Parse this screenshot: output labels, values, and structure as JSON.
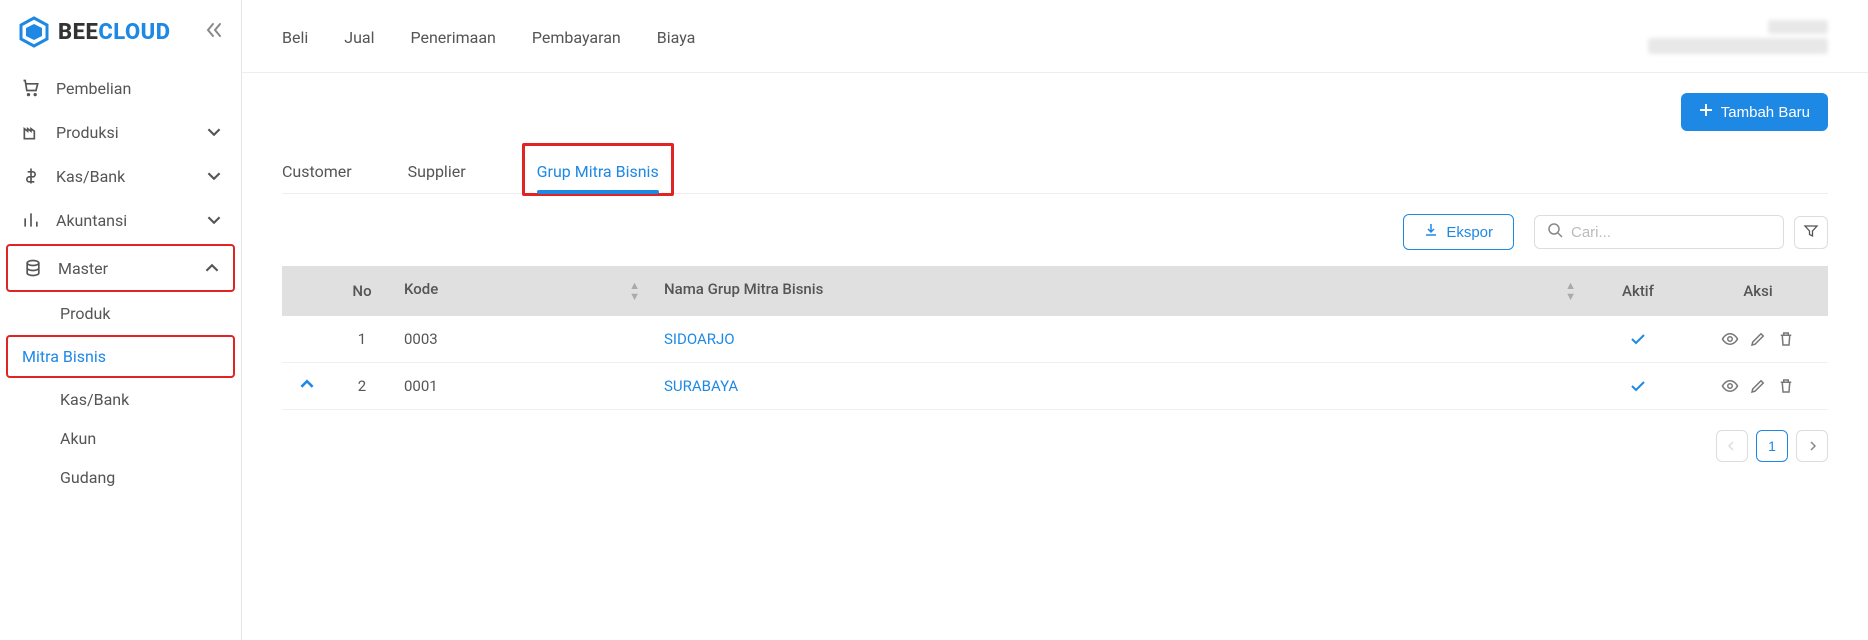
{
  "brand": {
    "bee": "BEE",
    "cloud": "CLOUD"
  },
  "sidebar": {
    "items": [
      {
        "label": "Pembelian",
        "icon": "cart",
        "expandable": false
      },
      {
        "label": "Produksi",
        "icon": "factory",
        "expandable": true
      },
      {
        "label": "Kas/Bank",
        "icon": "dollar",
        "expandable": true
      },
      {
        "label": "Akuntansi",
        "icon": "bars",
        "expandable": true
      },
      {
        "label": "Master",
        "icon": "db",
        "expandable": true,
        "open": true
      }
    ],
    "master_children": [
      {
        "label": "Produk"
      },
      {
        "label": "Mitra Bisnis",
        "active": true
      },
      {
        "label": "Kas/Bank"
      },
      {
        "label": "Akun"
      },
      {
        "label": "Gudang"
      }
    ]
  },
  "topnav": [
    "Beli",
    "Jual",
    "Penerimaan",
    "Pembayaran",
    "Biaya"
  ],
  "buttons": {
    "add": "Tambah Baru",
    "export": "Ekspor"
  },
  "search": {
    "placeholder": "Cari..."
  },
  "tabs": [
    "Customer",
    "Supplier",
    "Grup Mitra Bisnis"
  ],
  "table": {
    "headers": {
      "no": "No",
      "kode": "Kode",
      "nama": "Nama Grup Mitra Bisnis",
      "aktif": "Aktif",
      "aksi": "Aksi"
    },
    "rows": [
      {
        "no": "1",
        "kode": "0003",
        "nama": "SIDOARJO",
        "aktif": true
      },
      {
        "no": "2",
        "kode": "0001",
        "nama": "SURABAYA",
        "aktif": true,
        "expanded": true
      }
    ]
  },
  "pagination": {
    "current": "1"
  }
}
